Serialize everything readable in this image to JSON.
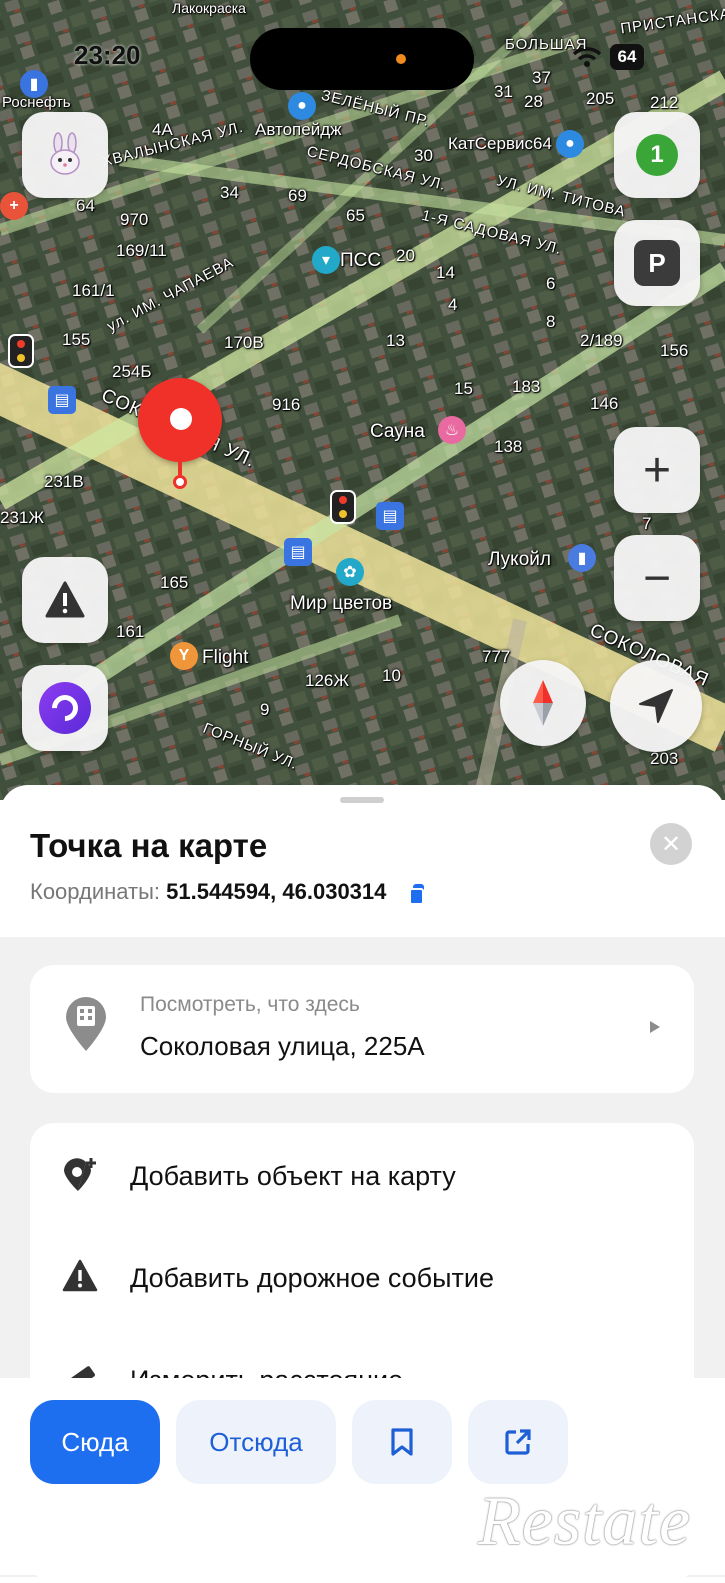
{
  "status_bar": {
    "time": "23:20",
    "battery": "64"
  },
  "map": {
    "streets": [
      "ул. ИМ. ЧАПАЕВА",
      "СОКОЛОВАЯ УЛ.",
      "СОКОЛОВАЯ",
      "ХВАЛЫНСКАЯ УЛ.",
      "СЕРДОБСКАЯ УЛ.",
      "УЛ. ИМ. ТИТОВА",
      "1-Я САДОВАЯ УЛ.",
      "ГОРНЫЙ УЛ.",
      "ЗЕЛЁНЫЙ ПР.",
      "БОЛЬШАЯ",
      "ПРИСТАНСКАЯ"
    ],
    "places": [
      "Лакокраска",
      "Роснефть",
      "Автопейдж",
      "КатСервис64",
      "ПСС",
      "Сауна",
      "Лукойл",
      "Мир цветов",
      "Flight"
    ],
    "house_numbers": [
      "970",
      "169/11",
      "161/1",
      "155",
      "170В",
      "254Б",
      "916",
      "231В",
      "231Ж",
      "165",
      "161",
      "126Ж",
      "10",
      "9",
      "777",
      "138",
      "183",
      "146",
      "156",
      "2/189",
      "13",
      "15",
      "8",
      "6",
      "4",
      "34",
      "69",
      "65",
      "20",
      "14",
      "28",
      "205",
      "212",
      "30",
      "4А",
      "37",
      "31",
      "64",
      "7",
      "203"
    ],
    "traffic_level": "1",
    "parking_label": "P"
  },
  "controls": {
    "zoom_in": "+",
    "zoom_out": "−"
  },
  "sheet": {
    "title": "Точка на карте",
    "coords_label": "Координаты:",
    "coords_value": "51.544594, 46.030314",
    "whats_here_hint": "Посмотреть, что здесь",
    "address": "Соколовая улица, 225А",
    "actions": [
      {
        "label": "Добавить объект на карту",
        "icon": "add-place-icon"
      },
      {
        "label": "Добавить дорожное событие",
        "icon": "road-warning-icon"
      },
      {
        "label": "Измерить расстояние",
        "icon": "ruler-icon"
      }
    ]
  },
  "bottom": {
    "to_here": "Сюда",
    "from_here": "Отсюда",
    "bookmark_icon": "bookmark-icon",
    "share_icon": "share-icon"
  },
  "watermark": "Restate",
  "colors": {
    "accent": "#1e6ef0",
    "pin": "#f0312a",
    "traffic": "#3aa638",
    "road": "#efe39a"
  }
}
